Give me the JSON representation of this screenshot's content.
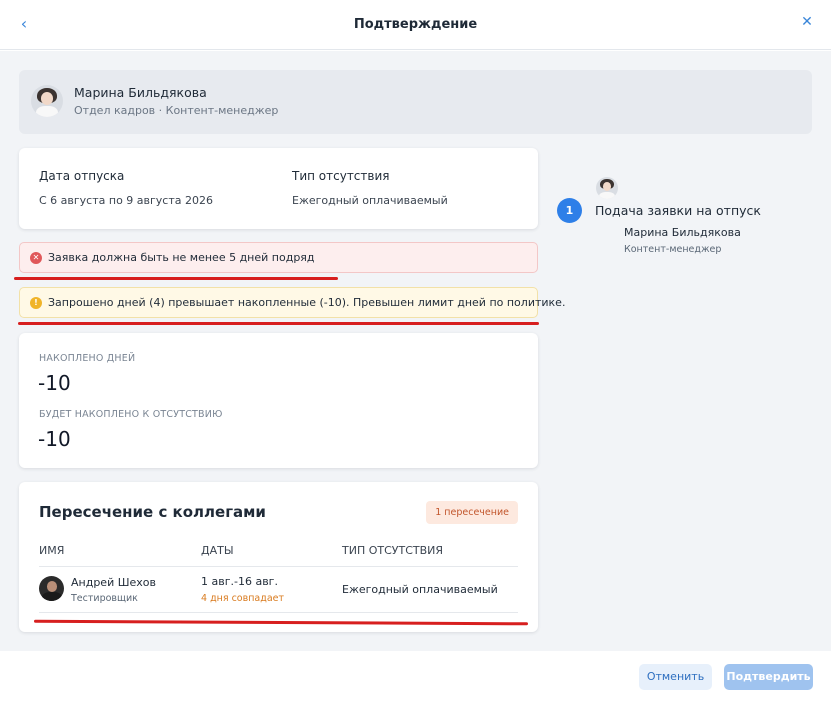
{
  "header": {
    "title": "Подтверждение",
    "back_icon": "‹",
    "close_icon": "✕"
  },
  "user": {
    "name": "Марина Бильдякова",
    "role": "Отдел кадров · Контент-менеджер"
  },
  "request": {
    "date_label": "Дата отпуска",
    "date_value": "С 6 августа по 9 августа 2026",
    "type_label": "Тип отсутствия",
    "type_value": "Ежегодный оплачиваемый"
  },
  "alerts": {
    "error_icon": "✕",
    "error": "Заявка должна быть не менее 5 дней подряд",
    "warning_icon": "!",
    "warning": "Запрошено дней (4) превышает накопленные (-10). Превышен лимит дней по политике."
  },
  "stats": {
    "accrued_label": "НАКОПЛЕНО ДНЕЙ",
    "accrued_value": "-10",
    "future_label": "БУДЕТ НАКОПЛЕНО К ОТСУТСТВИЮ",
    "future_value": "-10"
  },
  "overlap": {
    "title": "Пересечение с коллегами",
    "badge": "1 пересечение",
    "columns": [
      "ИМЯ",
      "ДАТЫ",
      "ТИП ОТСУТСТВИЯ"
    ],
    "rows": [
      {
        "name": "Андрей Шехов",
        "position": "Тестировщик",
        "dates": "1 авг.-16 авг.",
        "overlap": "4 дня совпадает",
        "type": "Ежегодный оплачиваемый"
      }
    ]
  },
  "approval": {
    "step_number": "1",
    "step_title": "Подача заявки на отпуск",
    "person_name": "Марина Бильдякова",
    "person_role": "Контент-менеджер"
  },
  "footer": {
    "cancel": "Отменить",
    "confirm": "Подтвердить"
  },
  "colors": {
    "accent": "#2e7fe8",
    "error": "#e0585a",
    "warning": "#f0b429",
    "annotation_line": "#d71f1f"
  }
}
